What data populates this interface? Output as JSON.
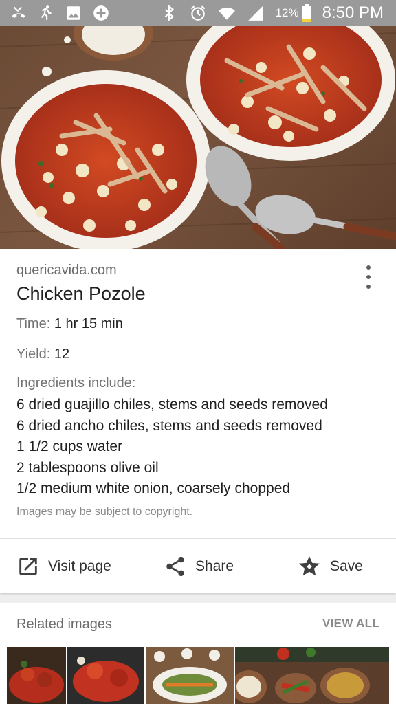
{
  "status_bar": {
    "battery_percent": "12%",
    "time": "8:50 PM",
    "left_icons": [
      "missed-call-icon",
      "running-icon",
      "image-icon",
      "add-circle-icon"
    ],
    "right_icons": [
      "bluetooth-icon",
      "alarm-icon",
      "wifi-icon",
      "signal-icon",
      "battery-icon"
    ]
  },
  "result": {
    "site": "quericavida.com",
    "title": "Chicken Pozole",
    "time_label": "Time:",
    "time_value": "1 hr 15 min",
    "yield_label": "Yield:",
    "yield_value": "12",
    "ingredients_label": "Ingredients include:",
    "ingredients": [
      "6 dried guajillo chiles, stems and seeds removed",
      "6 dried ancho chiles, stems and seeds removed",
      "1 1/2 cups water",
      "2 tablespoons olive oil",
      "1/2 medium white onion, coarsely chopped"
    ],
    "copyright_note": "Images may be subject to copyright."
  },
  "actions": {
    "visit_label": "Visit page",
    "share_label": "Share",
    "save_label": "Save"
  },
  "related": {
    "title": "Related images",
    "view_all": "VIEW ALL"
  },
  "colors": {
    "status_bar": "#9a9a9a",
    "battery_low": "#f4d03f",
    "broth": "#c0391f",
    "bowl": "#f4f0ea",
    "table": "#6b4a35"
  }
}
